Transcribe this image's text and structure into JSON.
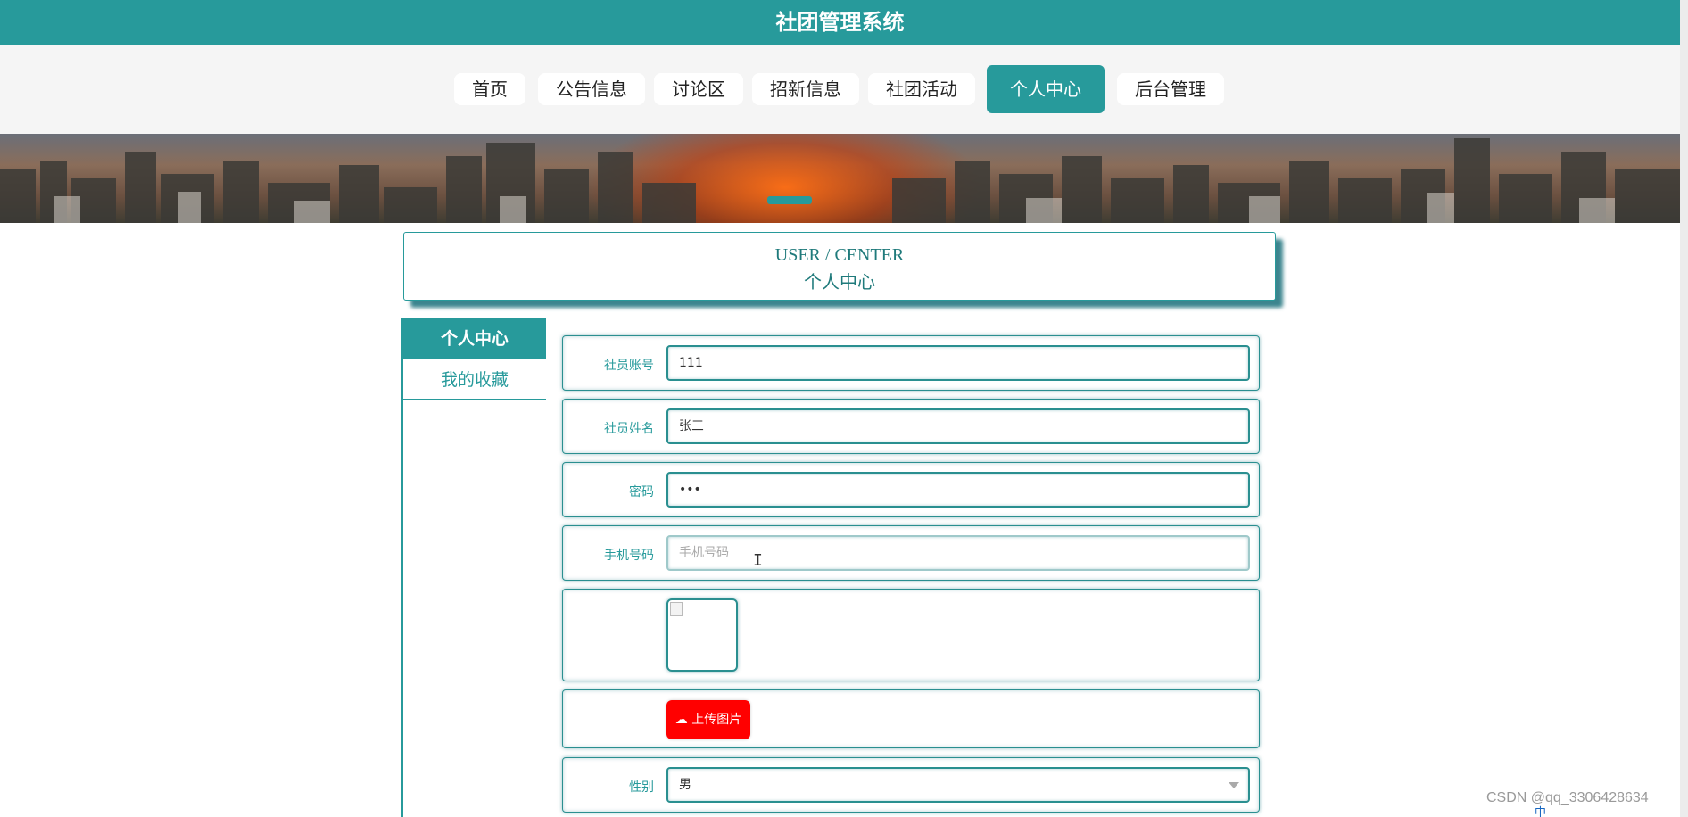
{
  "app": {
    "title": "社团管理系统"
  },
  "nav": {
    "items": [
      {
        "label": "首页"
      },
      {
        "label": "公告信息"
      },
      {
        "label": "讨论区"
      },
      {
        "label": "招新信息"
      },
      {
        "label": "社团活动"
      },
      {
        "label": "个人中心",
        "active": true
      },
      {
        "label": "后台管理"
      }
    ]
  },
  "heading": {
    "en": "USER / CENTER",
    "cn": "个人中心"
  },
  "sidebar": {
    "items": [
      {
        "label": "个人中心",
        "active": true
      },
      {
        "label": "我的收藏"
      }
    ]
  },
  "form": {
    "account": {
      "label": "社员账号",
      "value": "111"
    },
    "name": {
      "label": "社员姓名",
      "value": "张三"
    },
    "password": {
      "label": "密码",
      "value": "•••"
    },
    "phone": {
      "label": "手机号码",
      "placeholder": "手机号码",
      "value": ""
    },
    "upload_button": "上传图片",
    "gender": {
      "label": "性别",
      "value": "男"
    }
  },
  "watermark": "CSDN @qq_3306428634",
  "tray": "中",
  "colors": {
    "accent": "#279a9b",
    "upload": "#ff0000",
    "nav_bg": "#f5f5f5"
  }
}
